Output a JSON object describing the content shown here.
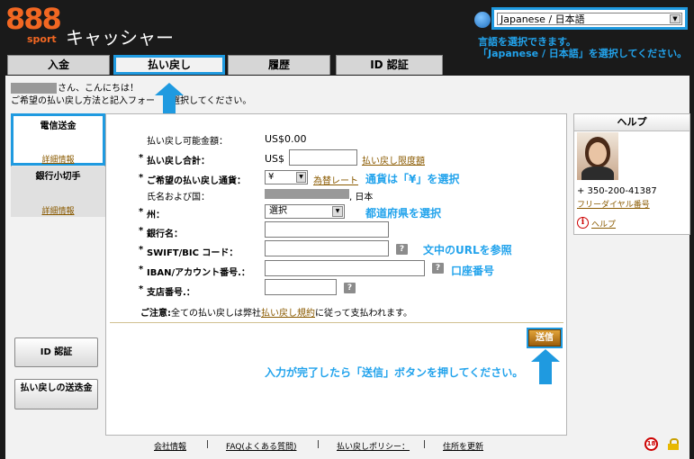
{
  "header": {
    "logo_888": "888",
    "logo_sport": "sport",
    "title": "キャッシャー"
  },
  "language": {
    "selected": "Japanese / 日本語",
    "note_line1": "言語を選択できます。",
    "note_line2": "「Japanese / 日本語」を選択してください。"
  },
  "tabs": [
    {
      "label": "入金"
    },
    {
      "label": "払い戻し"
    },
    {
      "label": "履歴"
    },
    {
      "label": "ID 認証"
    }
  ],
  "greeting": {
    "line1_suffix": "さん、こんにちは！",
    "line2": "ご希望の払い戻し方法と記入フォー",
    "line2_rest": "選択してください。"
  },
  "methods": [
    {
      "title": "電信送金",
      "link": "詳細情報"
    },
    {
      "title": "銀行小切手",
      "link": "詳細情報"
    }
  ],
  "side_buttons": {
    "id_verify": "ID 認証",
    "address": "払い戻しの送迭金"
  },
  "form": {
    "available_label": "払い戻し可能金額：",
    "available_value": "US$0.00",
    "total_label": "払い戻し合計：",
    "total_prefix": "US$",
    "total_value": "",
    "limit_link": "払い戻し限度額",
    "currency_label": "ご希望の払い戻し通貨：",
    "currency_value": "¥",
    "rate_link": "為替レート",
    "name_label": "氏名および国：",
    "name_suffix": ", 日本",
    "state_label": "州：",
    "state_value": "選択",
    "bank_label": "銀行名：",
    "swift_label": "SWIFT/BIC コード：",
    "iban_label": "IBAN/アカウント番号.：",
    "branch_label": "支店番号.：",
    "notice_prefix": "ご注意:",
    "notice_mid": "全ての払い戻しは弊社",
    "notice_link": "払い戻し規約",
    "notice_suffix": "に従って支払われます。",
    "submit": "送信",
    "required_mark": "*",
    "help_q": "?"
  },
  "annotations": {
    "currency": "通貨は「¥」を選択",
    "state": "都道府県を選択",
    "swift": "文中のURLを参照",
    "iban": "口座番号",
    "submit": "入力が完了したら「送信」ボタンを押してください。"
  },
  "help": {
    "title": "ヘルプ",
    "phone": "+ 350-200-41387",
    "freedial": "フリーダイヤル番号",
    "help_link": "ヘルプ",
    "info_icon_char": "i"
  },
  "footer": {
    "links": [
      "会社情報",
      "FAQ(よくある質問)",
      "払い戻しポリシー：",
      "住所を更新"
    ],
    "sep": "|",
    "age_badge": "18"
  },
  "colors": {
    "accent": "#1f9ae0",
    "brand": "#f26722",
    "link": "#8a5a00"
  }
}
